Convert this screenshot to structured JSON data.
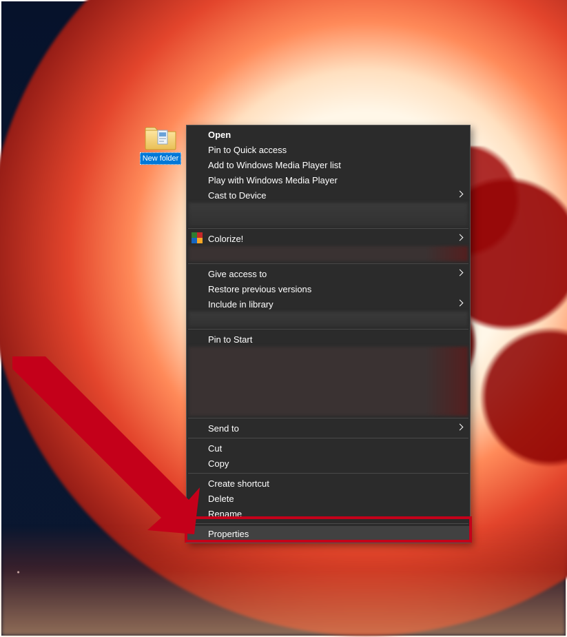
{
  "desktop_icon": {
    "label": "New folder"
  },
  "context_menu": {
    "items": {
      "open": "Open",
      "pin_quick": "Pin to Quick access",
      "add_wmp_list": "Add to Windows Media Player list",
      "play_wmp": "Play with Windows Media Player",
      "cast_device": "Cast to Device",
      "colorize": "Colorize!",
      "give_access": "Give access to",
      "restore_prev": "Restore previous versions",
      "include_library": "Include in library",
      "pin_start": "Pin to Start",
      "send_to": "Send to",
      "cut": "Cut",
      "copy": "Copy",
      "create_shortcut": "Create shortcut",
      "delete": "Delete",
      "rename": "Rename",
      "properties": "Properties"
    }
  },
  "annotation": {
    "highlighted_item": "properties"
  }
}
